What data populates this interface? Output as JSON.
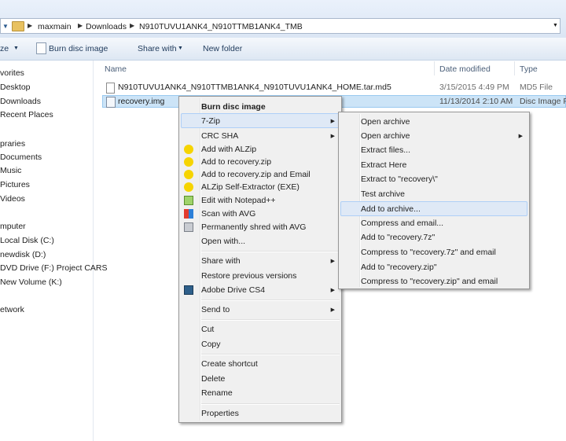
{
  "breadcrumb": [
    "maxmain",
    "Downloads",
    "N910TUVU1ANK4_N910TTMB1ANK4_TMB"
  ],
  "toolbar": {
    "organize": "ze",
    "burn": "Burn disc image",
    "share": "Share with",
    "new_folder": "New folder"
  },
  "nav": [
    "vorites",
    "Desktop",
    "Downloads",
    "Recent Places",
    "praries",
    "Documents",
    "Music",
    "Pictures",
    "Videos",
    "mputer",
    "Local Disk (C:)",
    "newdisk (D:)",
    "DVD Drive (F:) Project CARS",
    "New Volume (K:)",
    "etwork"
  ],
  "columns": {
    "name": "Name",
    "date": "Date modified",
    "type": "Type"
  },
  "files": [
    {
      "name": "N910TUVU1ANK4_N910TTMB1ANK4_N910TUVU1ANK4_HOME.tar.md5",
      "date": "3/15/2015 4:49 PM",
      "type": "MD5 File"
    },
    {
      "name": "recovery.img",
      "date": "11/13/2014 2:10 AM",
      "type": "Disc Image File"
    }
  ],
  "context_menu": {
    "items": [
      "Burn disc image",
      "7-Zip",
      "CRC SHA",
      "Add with ALZip",
      "Add to recovery.zip",
      "Add to recovery.zip and Email",
      "ALZip Self-Extractor (EXE)",
      "Edit with Notepad++",
      "Scan with AVG",
      "Permanently shred with AVG",
      "Open with...",
      "Share with",
      "Restore previous versions",
      "Adobe Drive CS4",
      "Send to",
      "Cut",
      "Copy",
      "Create shortcut",
      "Delete",
      "Rename",
      "Properties"
    ]
  },
  "submenu": {
    "items": [
      "Open archive",
      "Open archive",
      "Extract files...",
      "Extract Here",
      "Extract to \"recovery\\\"",
      "Test archive",
      "Add to archive...",
      "Compress and email...",
      "Add to \"recovery.7z\"",
      "Compress to \"recovery.7z\" and email",
      "Add to \"recovery.zip\"",
      "Compress to \"recovery.zip\" and email"
    ]
  },
  "colors": {
    "selection": "#cce4f7",
    "menu_bg": "#f0f0f0",
    "highlight": "#dfe9f6"
  }
}
